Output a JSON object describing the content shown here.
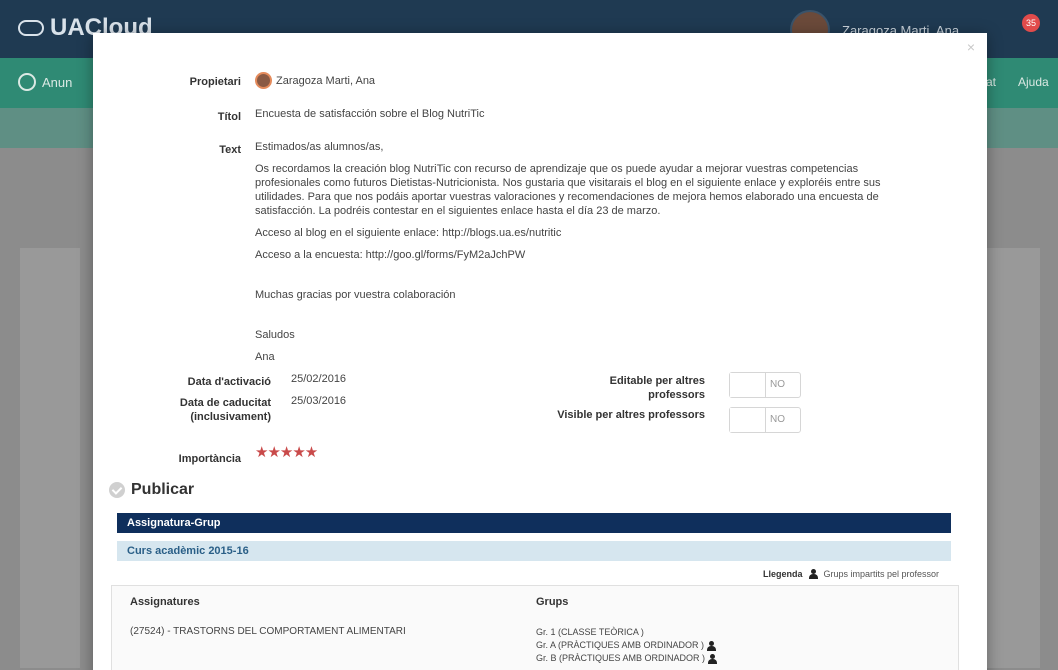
{
  "app": {
    "brand": "UACloud",
    "nav_left": "Anun",
    "nav_right_1": "at",
    "nav_right_2": "Ajuda",
    "user_name": "Zaragoza Marti, Ana",
    "notif_count": "35"
  },
  "modal": {
    "close": "×",
    "owner": {
      "label": "Propietari",
      "value": "Zaragoza Marti, Ana"
    },
    "title": {
      "label": "Títol",
      "value": "Encuesta de satisfacción sobre el Blog NutriTic"
    },
    "text": {
      "label": "Text",
      "paragraphs": [
        "Estimados/as alumnos/as,",
        "Os recordamos la creación blog NutriTic con recurso de aprendizaje que os puede ayudar a mejorar vuestras competencias profesionales como futuros Dietistas-Nutricionista. Nos gustaria que visitarais el blog en el siguiente enlace y exploréis entre sus utilidades. Para que nos podáis aportar vuestras valoraciones y recomendaciones de mejora hemos elaborado una encuesta de satisfacción. La podréis contestar en el siguientes enlace hasta el día 23 de marzo.",
        "Acceso al blog en el siguiente enlace: http://blogs.ua.es/nutritic",
        "Acceso a la encuesta: http://goo.gl/forms/FyM2aJchPW",
        "Muchas gracias por vuestra colaboración",
        "Saludos",
        "Ana"
      ]
    },
    "activation": {
      "label": "Data d'activació",
      "value": "25/02/2016"
    },
    "expiry": {
      "label": "Data de caducitat (inclusivament)",
      "value": "25/03/2016"
    },
    "editable": {
      "label": "Editable per altres professors",
      "value": "NO"
    },
    "visible": {
      "label": "Visible per altres professors",
      "value": "NO"
    },
    "importance": {
      "label": "Importància",
      "stars": "★★★★★"
    },
    "publish": {
      "title": "Publicar",
      "header": "Assignatura-Grup",
      "year": "Curs acadèmic 2015-16",
      "legend_label": "Llegenda",
      "legend_text": "Grups impartits pel professor",
      "table": {
        "col_subjects": "Assignatures",
        "col_groups": "Grups",
        "subject": "(27524) - TRASTORNS DEL COMPORTAMENT ALIMENTARI",
        "groups": [
          "Gr. 1 (CLASSE TEÒRICA )",
          "Gr. A (PRÀCTIQUES AMB ORDINADOR )",
          "Gr. B (PRÀCTIQUES AMB ORDINADOR )"
        ]
      }
    }
  }
}
